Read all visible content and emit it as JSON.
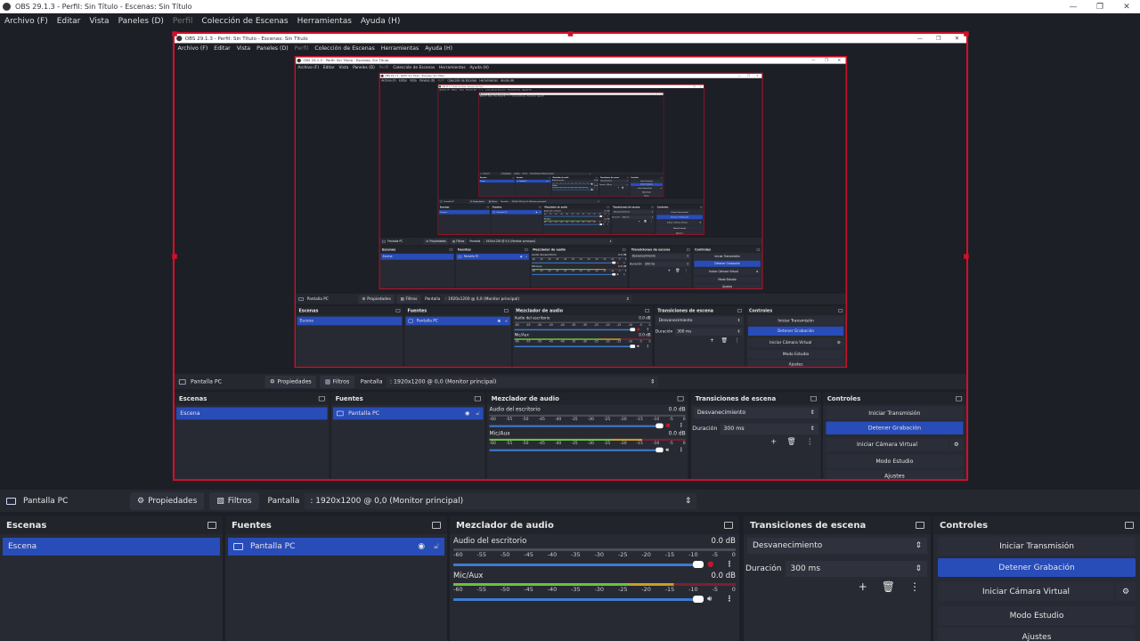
{
  "window_title": "OBS 29.1.3 - Perfil: Sin Título - Escenas: Sin Título",
  "window_controls": [
    "—",
    "❐",
    "✕"
  ],
  "menu": [
    "Archivo (F)",
    "Editar",
    "Vista",
    "Paneles (D)",
    "Perfil",
    "Colección de Escenas",
    "Herramientas",
    "Ayuda (H)"
  ],
  "source_toolbar": {
    "source_name": "Pantalla PC",
    "properties": "Propiedades",
    "filters": "Filtros",
    "display_label": "Pantalla",
    "display_value": ": 1920x1200 @ 0,0 (Monitor principal)"
  },
  "scenes": {
    "title": "Escenas",
    "items": [
      "Escena"
    ]
  },
  "sources": {
    "title": "Fuentes",
    "items": [
      "Pantalla PC"
    ]
  },
  "mixer": {
    "title": "Mezclador de audio",
    "ticks": [
      "-60",
      "-55",
      "-50",
      "-45",
      "-40",
      "-35",
      "-30",
      "-25",
      "-20",
      "-15",
      "-10",
      "-5",
      "0"
    ],
    "tracks": [
      {
        "name": "Audio del escritorio",
        "level": "0.0 dB",
        "muted": true
      },
      {
        "name": "Mic/Aux",
        "level": "0.0 dB",
        "muted": false
      }
    ]
  },
  "transitions": {
    "title": "Transiciones de escena",
    "selected": "Desvanecimiento",
    "duration_label": "Duración",
    "duration_value": "300 ms"
  },
  "controls": {
    "title": "Controles",
    "buttons": [
      "Iniciar Transmisión",
      "Detener Grabación",
      "Iniciar Cámara Virtual",
      "Modo Estudio",
      "Ajustes"
    ]
  },
  "colors": {
    "accent": "#284cb8",
    "selection_border": "#d0102a"
  }
}
